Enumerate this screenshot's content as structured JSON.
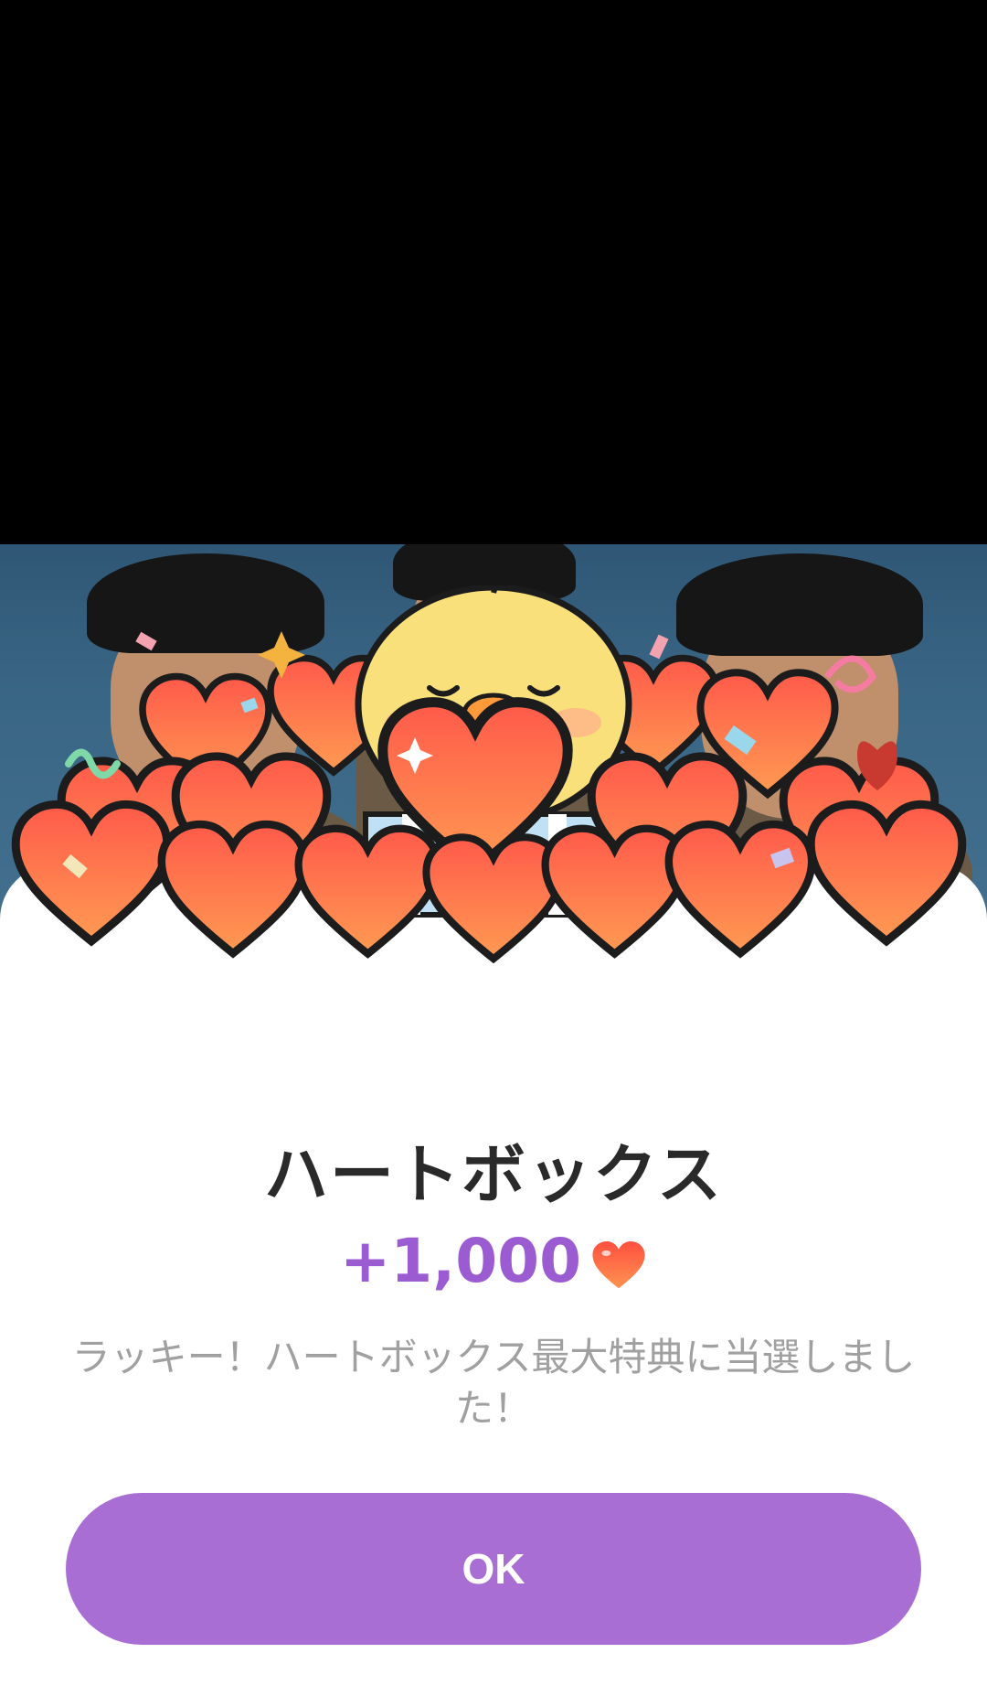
{
  "dialog": {
    "title": "ハートボックス",
    "reward_amount": "+1,000",
    "message": "ラッキー！ハートボックス最大特典に当選しました！",
    "ok_label": "OK"
  },
  "colors": {
    "accent": "#a86ed4",
    "reward_text": "#9a5cd0",
    "heart": "#f25c3d"
  },
  "icons": {
    "reward_icon": "heart-icon",
    "mascot": "yellow-chick-holding-heart"
  }
}
